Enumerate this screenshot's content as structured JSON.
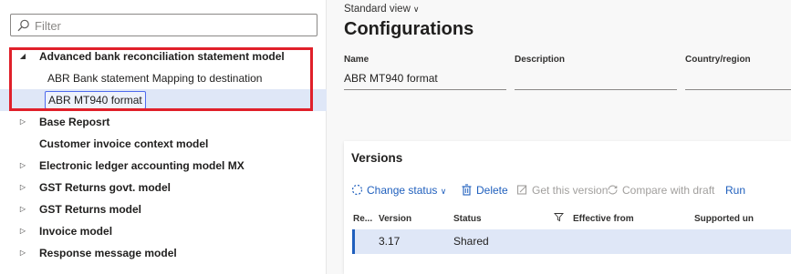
{
  "filter": {
    "placeholder": "Filter"
  },
  "tree": {
    "items": [
      {
        "label": "Advanced bank reconciliation statement model",
        "expanded": true
      },
      {
        "label": "ABR Bank statement Mapping to destination"
      },
      {
        "label": "ABR MT940 format",
        "selected": true
      },
      {
        "label": "Base Reposrt"
      },
      {
        "label": "Customer invoice context model"
      },
      {
        "label": "Electronic ledger accounting model MX"
      },
      {
        "label": "GST Returns govt. model"
      },
      {
        "label": "GST Returns model"
      },
      {
        "label": "Invoice model"
      },
      {
        "label": "Response message model"
      }
    ]
  },
  "header": {
    "view_selector": "Standard view",
    "title": "Configurations"
  },
  "form": {
    "name_label": "Name",
    "name_value": "ABR MT940 format",
    "description_label": "Description",
    "description_value": "",
    "country_label": "Country/region",
    "country_value": ""
  },
  "versions": {
    "title": "Versions",
    "toolbar": {
      "change_status": "Change status",
      "delete": "Delete",
      "get_version": "Get this version",
      "compare": "Compare with draft",
      "run": "Run"
    },
    "columns": {
      "re": "Re...",
      "version": "Version",
      "status": "Status",
      "effective_from": "Effective from",
      "supported": "Supported un"
    },
    "rows": [
      {
        "version": "3.17",
        "status": "Shared"
      }
    ]
  },
  "colors": {
    "accent": "#1f5fbd",
    "selection": "#dfe7f7",
    "highlight_border": "#e0202a"
  }
}
